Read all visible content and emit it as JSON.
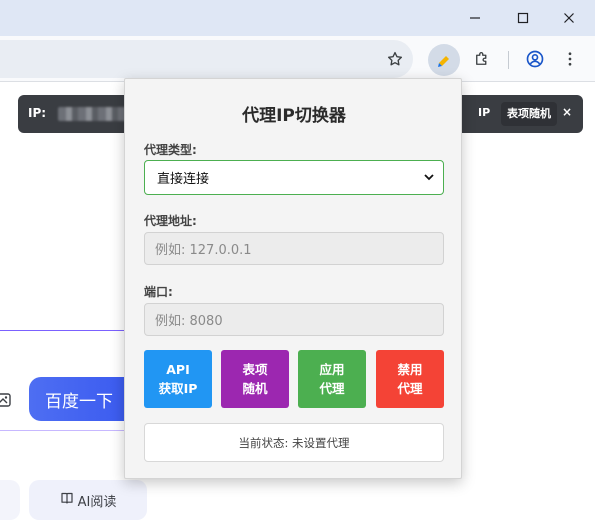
{
  "colors": {
    "api_button": "#2196f3",
    "random_button": "#9c27b0",
    "apply_button": "#4caf50",
    "disable_button": "#f44336",
    "select_border": "#4caf50"
  },
  "browser": {
    "minimize_icon": "minimize-icon",
    "maximize_icon": "maximize-icon",
    "close_icon": "close-icon",
    "star_icon": "star-icon",
    "extension_icon": "proxy-extension-icon",
    "puzzle_icon": "puzzle-icon",
    "profile_icon": "profile-icon",
    "menu_icon": "more-vert-icon"
  },
  "banner": {
    "ip_label": "IP:",
    "right_prefix": "IP",
    "random_label": "表项随机",
    "close_glyph": "×"
  },
  "page": {
    "search_button": "百度一下",
    "ai_read_label": "AI阅读"
  },
  "popup": {
    "title": "代理IP切换器",
    "proxy_type_label": "代理类型:",
    "proxy_type_value": "直接连接",
    "proxy_address_label": "代理地址:",
    "proxy_address_placeholder": "例如: 127.0.0.1",
    "port_label": "端口:",
    "port_placeholder": "例如: 8080",
    "buttons": {
      "api": "API\n获取IP",
      "random": "表项\n随机",
      "apply": "应用\n代理",
      "disable": "禁用\n代理"
    },
    "status": "当前状态: 未设置代理"
  }
}
